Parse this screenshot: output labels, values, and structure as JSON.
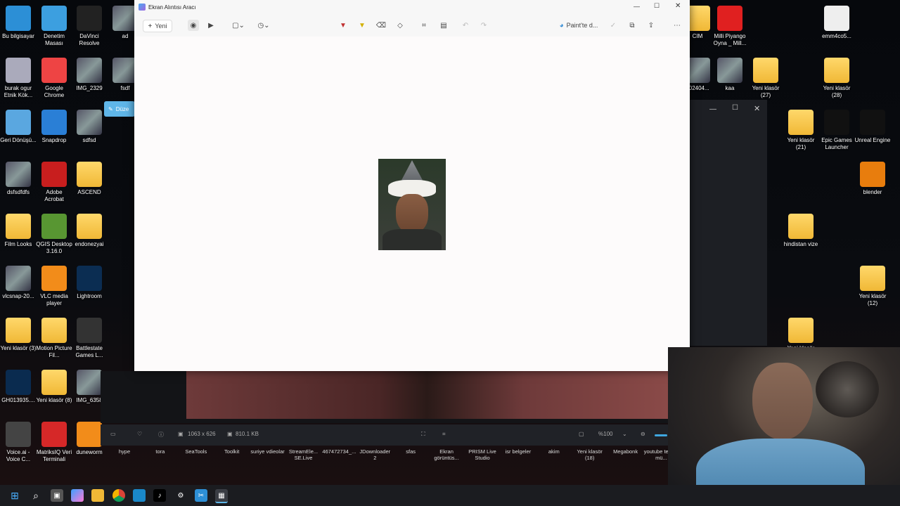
{
  "desktop_icons": [
    {
      "label": "Bu bilgisayar",
      "icon": "monitor-icon"
    },
    {
      "label": "Denetim Masası",
      "icon": "control-panel-icon"
    },
    {
      "label": "DaVinci Resolve",
      "icon": "davinci-icon"
    },
    {
      "label": "ad",
      "icon": "image-icon"
    },
    {
      "label": "burak ogur Etnik Kök...",
      "icon": "ball-icon"
    },
    {
      "label": "Google Chrome",
      "icon": "chrome-icon"
    },
    {
      "label": "IMG_2329",
      "icon": "image-icon"
    },
    {
      "label": "fsdf",
      "icon": "image-icon"
    },
    {
      "label": "Geri Dönüşü...",
      "icon": "recycle-bin-icon"
    },
    {
      "label": "Snapdrop",
      "icon": "snapdrop-icon"
    },
    {
      "label": "sdfsd",
      "icon": "image-icon"
    },
    {
      "label": "dsfsdfdfs",
      "icon": "image-icon"
    },
    {
      "label": "Adobe Acrobat",
      "icon": "acrobat-icon"
    },
    {
      "label": "ASCEND",
      "icon": "folder-icon"
    },
    {
      "label": "Film Looks",
      "icon": "folder-icon"
    },
    {
      "label": "QGIS Desktop 3.16.0",
      "icon": "qgis-icon"
    },
    {
      "label": "endonezyai",
      "icon": "folder-icon"
    },
    {
      "label": "vlcsnap-20...",
      "icon": "image-icon"
    },
    {
      "label": "VLC media player",
      "icon": "vlc-icon"
    },
    {
      "label": "Lightroom",
      "icon": "lightroom-icon"
    },
    {
      "label": "Yeni klasör (3)",
      "icon": "folder-icon"
    },
    {
      "label": "Motion Picture Fil...",
      "icon": "folder-icon"
    },
    {
      "label": "Battlestate Games L...",
      "icon": "battlestate-icon"
    },
    {
      "label": "GH013935....",
      "icon": "photoshop-file-icon"
    },
    {
      "label": "Yeni klasör (8)",
      "icon": "folder-icon"
    },
    {
      "label": "IMG_6358",
      "icon": "image-icon"
    },
    {
      "label": "Voice.ai - Voice C...",
      "icon": "microphone-icon"
    },
    {
      "label": "MatriksIQ Veri Terminali",
      "icon": "matriks-icon"
    },
    {
      "label": "duneworm",
      "icon": "vlc-icon"
    }
  ],
  "right_icons": [
    {
      "label": "CIM",
      "icon": "folder-icon"
    },
    {
      "label": "Milli Piyango Oyna _ Mill...",
      "icon": "pdf-icon"
    },
    {
      "label": "emm4co5...",
      "icon": "file-icon"
    },
    {
      "label": "202404...",
      "icon": "image-icon"
    },
    {
      "label": "kaa",
      "icon": "image-icon"
    },
    {
      "label": "Yeni klasör (27)",
      "icon": "folder-icon"
    },
    {
      "label": "Yeni klasör (28)",
      "icon": "folder-icon"
    },
    {
      "label": "Yeni klasör (21)",
      "icon": "folder-icon"
    },
    {
      "label": "Epic Games Launcher",
      "icon": "epic-icon"
    },
    {
      "label": "Unreal Engine",
      "icon": "unreal-icon"
    },
    {
      "label": "blender",
      "icon": "blender-icon"
    },
    {
      "label": "hindistan vize",
      "icon": "folder-icon"
    },
    {
      "label": "Yeni klasör (12)",
      "icon": "folder-icon"
    },
    {
      "label": "Yeni klasör",
      "icon": "folder-icon"
    }
  ],
  "snip": {
    "title": "Ekran Alıntısı Aracı",
    "new_label": "Yeni",
    "paint_label": "Paint'te d...",
    "badge": "Düze"
  },
  "editor": {
    "dimensions": "1063 x 626",
    "filesize": "810.1 KB",
    "zoom": "%100"
  },
  "shelf": [
    "hype",
    "tora",
    "SeaTools",
    "Toolkit",
    "suriye vdieolar",
    "StreamEle... SE.Live",
    "467472734_...",
    "JDownloader 2",
    "sfas",
    "Ekran görüntüs...",
    "PRISM Live Studio",
    "isr belgeler",
    "akim",
    "Yeni klasör (18)",
    "Megabonk",
    "youtube telifsiz mü..."
  ],
  "taskbar_items": [
    "windows-start-icon",
    "search-icon",
    "task-view-icon",
    "copilot-icon",
    "file-explorer-icon",
    "chrome-icon",
    "store-icon",
    "tiktok-icon",
    "settings-icon",
    "snipping-icon",
    "app-icon"
  ]
}
